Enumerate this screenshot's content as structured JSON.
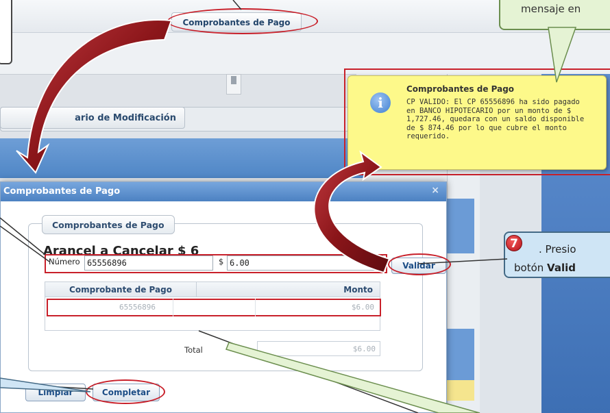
{
  "background": {
    "tab_comprobantes": "Comprobantes de Pago",
    "tab_modificacion": "ario de Modificación"
  },
  "callout_top_right": {
    "text": "mensaje en"
  },
  "notification": {
    "title": "Comprobantes de Pago",
    "message": "CP VALIDO: El CP 65556896 ha sido pagado en BANCO HIPOTECARIO por un monto de $ 1,727.46, quedara con un saldo disponible de $ 874.46 por lo que cubre el monto requerido.",
    "icon": "info-icon"
  },
  "dialog": {
    "title": "Comprobantes de Pago",
    "close_glyph": "×",
    "legend": "Comprobantes de Pago",
    "arancel": "Arancel a Cancelar $ 6",
    "numero_label": "Número",
    "numero_value": "65556896",
    "dollar_label": "$",
    "monto_value": "6.00",
    "validar_label": "Validar",
    "grid": {
      "columns": [
        "Comprobante de Pago",
        "Monto"
      ],
      "rows": [
        {
          "comprobante": "65556896",
          "monto": "$6.00"
        }
      ],
      "total_label": "Total",
      "total_value": "$6.00"
    },
    "limpiar_label": "Limpiar",
    "completar_label": "Completar"
  },
  "step7": {
    "badge": "7",
    "line1": ". Presio",
    "line2_prefix": "botón ",
    "line2_bold": "Valid"
  },
  "colors": {
    "annotation_red": "#c8202a",
    "header_blue": "#4c81c2",
    "notification_yellow": "#fdf98a",
    "callout_green": "#e5f3d4",
    "callout_blue": "#cfe5f5",
    "arrow_red": "#9b1b22"
  }
}
